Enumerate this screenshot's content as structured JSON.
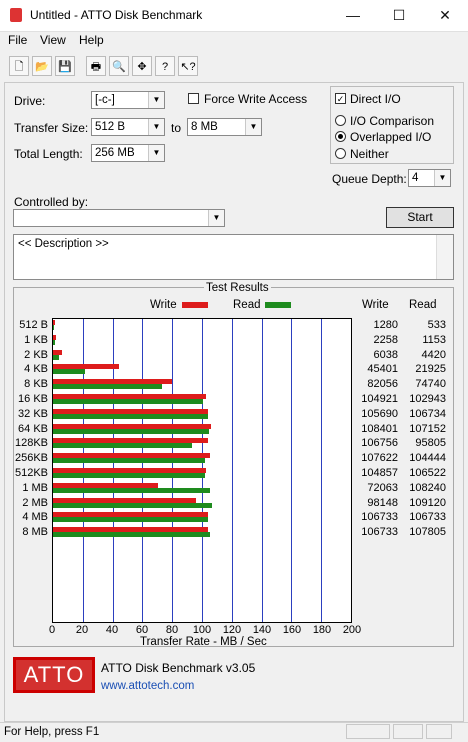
{
  "window": {
    "title": "Untitled - ATTO Disk Benchmark",
    "minimize": "—",
    "maximize": "☐",
    "close": "✕"
  },
  "menu": {
    "file": "File",
    "view": "View",
    "help": "Help"
  },
  "toolbar": {
    "icons": [
      "new-icon",
      "open-icon",
      "save-icon",
      "print-icon",
      "print-preview-icon",
      "move-icon",
      "help-icon",
      "context-help-icon"
    ],
    "glyphs": [
      "🗋",
      "📂",
      "💾",
      "🖶",
      "🔍",
      "✥",
      "?",
      "↖?"
    ]
  },
  "settings": {
    "drive_label": "Drive:",
    "drive_value": "[-c-]",
    "transfer_size_label": "Transfer Size:",
    "transfer_from": "512 B",
    "to_label": "to",
    "transfer_to": "8 MB",
    "total_length_label": "Total Length:",
    "total_length_value": "256 MB",
    "force_write_label": "Force Write Access",
    "direct_io_label": "Direct I/O",
    "io_comparison_label": "I/O Comparison",
    "overlapped_io_label": "Overlapped I/O",
    "neither_label": "Neither",
    "queue_depth_label": "Queue Depth:",
    "queue_depth_value": "4",
    "controlled_by_label": "Controlled by:",
    "controlled_by_value": "",
    "start_label": "Start",
    "description": "<< Description >>"
  },
  "results": {
    "title": "Test Results",
    "write_legend": "Write",
    "read_legend": "Read",
    "write_col": "Write",
    "read_col": "Read",
    "xlabel": "Transfer Rate - MB / Sec"
  },
  "chart_data": {
    "type": "bar",
    "orientation": "horizontal",
    "title": "Test Results",
    "xlabel": "Transfer Rate - MB / Sec",
    "xlim": [
      0,
      200
    ],
    "xticks": [
      "0",
      "20",
      "40",
      "60",
      "80",
      "100",
      "120",
      "140",
      "160",
      "180",
      "200"
    ],
    "categories": [
      "512 B",
      "1 KB",
      "2 KB",
      "4 KB",
      "8 KB",
      "16 KB",
      "32 KB",
      "64 KB",
      "128KB",
      "256KB",
      "512KB",
      "1 MB",
      "2 MB",
      "4 MB",
      "8 MB"
    ],
    "series": [
      {
        "name": "Write",
        "color": "#dd1c1c",
        "values": [
          1.25,
          2.2,
          5.9,
          44.3,
          80.1,
          102.5,
          104.2,
          105.9,
          104.3,
          105.1,
          102.4,
          70.4,
          95.8,
          104.2,
          104.2
        ],
        "labels": [
          "1280",
          "2258",
          "6038",
          "45401",
          "82056",
          "104921",
          "105690",
          "108401",
          "106756",
          "107622",
          "104857",
          "72063",
          "98148",
          "106733",
          "106733"
        ]
      },
      {
        "name": "Read",
        "color": "#1e8b1e",
        "values": [
          0.52,
          1.13,
          4.3,
          21.4,
          73.0,
          100.5,
          104.2,
          104.6,
          93.6,
          102.0,
          102.1,
          105.7,
          106.6,
          104.2,
          105.3
        ],
        "labels": [
          "533",
          "1153",
          "4420",
          "21925",
          "74740",
          "102943",
          "106734",
          "107152",
          "95805",
          "104444",
          "106522",
          "108240",
          "109120",
          "106733",
          "107805"
        ]
      }
    ]
  },
  "footer": {
    "logo_text": "ATTO",
    "product": "ATTO Disk Benchmark v3.05",
    "website": "www.attotech.com",
    "status": "For Help, press F1"
  }
}
